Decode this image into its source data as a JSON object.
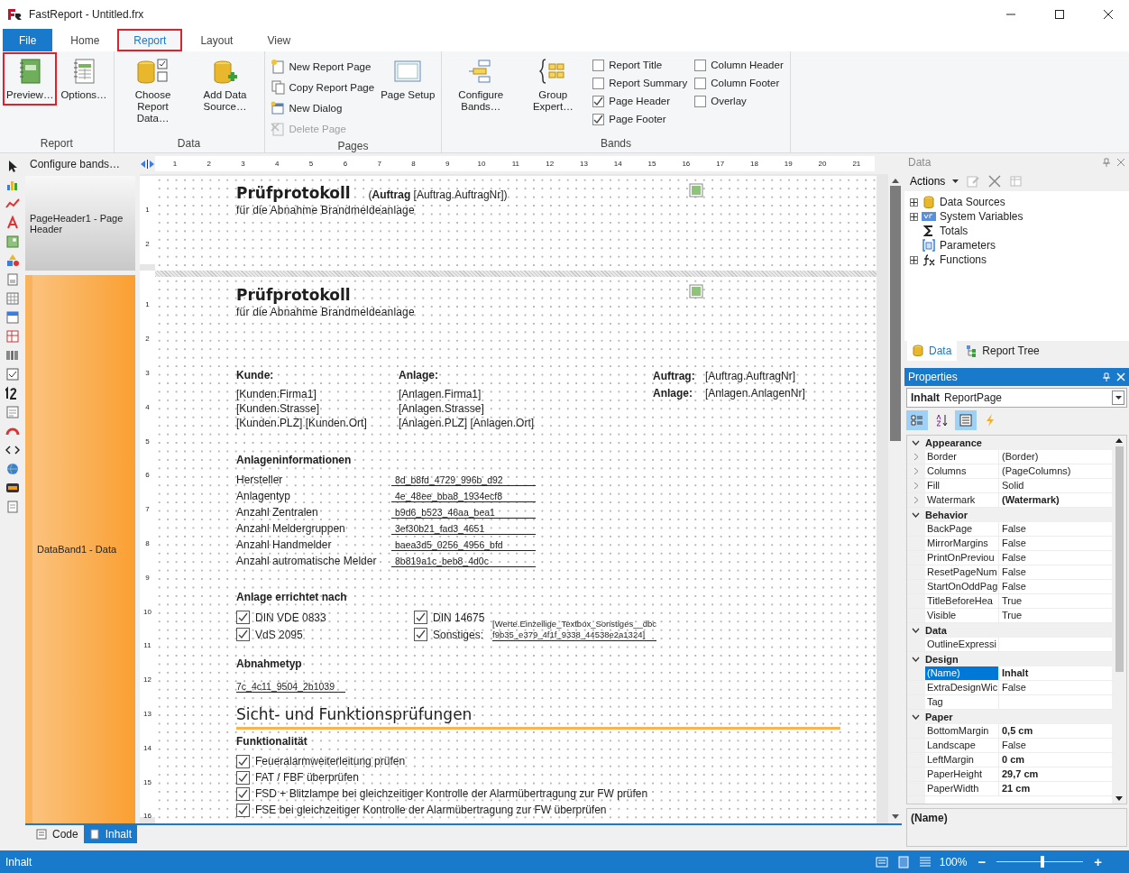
{
  "window": {
    "title": "FastReport - Untitled.frx"
  },
  "ribbon_tabs": [
    {
      "label": "File",
      "kind": "file",
      "selected": false,
      "highlighted": false
    },
    {
      "label": "Home",
      "kind": "tab",
      "selected": false,
      "highlighted": false
    },
    {
      "label": "Report",
      "kind": "tab",
      "selected": true,
      "highlighted": true
    },
    {
      "label": "Layout",
      "kind": "tab",
      "selected": false,
      "highlighted": false
    },
    {
      "label": "View",
      "kind": "tab",
      "selected": false,
      "highlighted": false
    }
  ],
  "ribbon_groups": [
    {
      "label": "Report",
      "items": [
        {
          "kind": "preview",
          "label": "Preview…",
          "highlighted": true
        },
        {
          "kind": "options",
          "label": "Options…",
          "highlighted": false
        }
      ]
    },
    {
      "label": "Data",
      "items": [
        {
          "kind": "choose-data",
          "label": "Choose Report Data…",
          "highlighted": false
        },
        {
          "kind": "add-source",
          "label": "Add Data Source…",
          "highlighted": false
        }
      ]
    },
    {
      "label": "Pages",
      "items": [
        {
          "kind": "new-page",
          "label": "New Report Page",
          "disabled": false
        },
        {
          "kind": "copy-page",
          "label": "Copy Report Page",
          "disabled": false
        },
        {
          "kind": "new-dialog",
          "label": "New Dialog",
          "disabled": false
        },
        {
          "kind": "delete-page",
          "label": "Delete Page",
          "disabled": true
        },
        {
          "kind": "page-setup",
          "label": "Page Setup",
          "highlighted": false
        }
      ]
    },
    {
      "label": "Bands",
      "items": [
        {
          "kind": "configure-bands",
          "label": "Configure Bands…",
          "highlighted": false
        },
        {
          "kind": "group-expert",
          "label": "Group Expert…",
          "highlighted": false
        },
        {
          "kind": "check",
          "label": "Report Title",
          "checked": false
        },
        {
          "kind": "check",
          "label": "Report Summary",
          "checked": false
        },
        {
          "kind": "check",
          "label": "Page Header",
          "checked": true
        },
        {
          "kind": "check",
          "label": "Page Footer",
          "checked": true
        },
        {
          "kind": "check",
          "label": "Column Header",
          "checked": false
        },
        {
          "kind": "check",
          "label": "Column Footer",
          "checked": false
        },
        {
          "kind": "check",
          "label": "Overlay",
          "checked": false
        }
      ]
    }
  ],
  "designer": {
    "hint": "Configure bands…",
    "ruler": [
      "1",
      "2",
      "3",
      "4",
      "5",
      "6",
      "7",
      "8",
      "9",
      "10",
      "11",
      "12",
      "13",
      "14",
      "15",
      "16",
      "17",
      "18",
      "19",
      "20",
      "21"
    ],
    "page_header": {
      "band_label": "PageHeader1 - Page Header",
      "ruler": [
        "1",
        "2"
      ],
      "title": "Prüfprotokoll",
      "order_ref": "(**Auftrag** [Auftrag.AuftragNr])",
      "subtitle": "für die Abnahme Brandmeldeanlage"
    },
    "data_band": {
      "band_label": "DataBand1 - Data",
      "ruler": [
        "1",
        "2",
        "3",
        "4",
        "5",
        "6",
        "7",
        "8",
        "9",
        "10",
        "11",
        "12",
        "13",
        "14",
        "15",
        "16"
      ],
      "title": "Prüfprotokoll",
      "subtitle": "für die Abnahme Brandmeldeanlage",
      "addresses": [
        {
          "heading": "Kunde:",
          "lines": [
            "[Kunden.Firma1]",
            "[Kunden.Strasse]",
            "[Kunden.PLZ] [Kunden.Ort]"
          ]
        },
        {
          "heading": "Anlage:",
          "lines": [
            "[Anlagen.Firma1]",
            "[Anlagen.Strasse]",
            "[Anlagen.PLZ] [Anlagen.Ort]"
          ]
        }
      ],
      "references": [
        {
          "label": "Auftrag:",
          "value": "[Auftrag.AuftragNr]"
        },
        {
          "label": "Anlage:",
          "value": "[Anlagen.AnlagenNr]"
        }
      ],
      "info": {
        "heading": "Anlageninformationen",
        "rows": [
          {
            "label": "Hersteller",
            "value": "8d_b8fd_4729_996b_d92"
          },
          {
            "label": "Anlagentyp",
            "value": "4e_48ee_bba8_1934ecf8"
          },
          {
            "label": "Anzahl Zentralen",
            "value": "b9d6_b523_46aa_bea1"
          },
          {
            "label": "Anzahl Meldergruppen",
            "value": "3ef30b21_fad3_4651"
          },
          {
            "label": "Anzahl Handmelder",
            "value": "baea3d5_0256_4956_bfd"
          },
          {
            "label": "Anzahl autromatische Melder",
            "value": "8b819a1c_beb8_4d0c"
          }
        ]
      },
      "standards": {
        "heading": "Anlage errichtet nach",
        "items": [
          {
            "label": "DIN VDE 0833",
            "checked": true
          },
          {
            "label": "VdS 2095",
            "checked": true
          },
          {
            "label": "DIN 14675",
            "checked": true
          },
          {
            "label": "Sonstiges:",
            "checked": true
          }
        ],
        "other_field": [
          "[Werte.Einzeilige_Textbox_Sonstiges__dbc",
          "f9b35_e379_4f1f_9338_44538e2a1324]"
        ]
      },
      "acceptance": {
        "heading": "Abnahmetyp",
        "value": "7c_4c11_9504_2b1039"
      },
      "section_title": "Sicht- und Funktionsprüfungen",
      "checks": {
        "heading": "Funktionalität",
        "items": [
          {
            "label": "Feueralarmweiterleitung prüfen",
            "checked": true
          },
          {
            "label": "FAT / FBF überprüfen",
            "checked": true
          },
          {
            "label": "FSD + Blitzlampe bei gleichzeitiger Kontrolle der Alarmübertragung zur FW prüfen",
            "checked": true
          },
          {
            "label": "FSE bei gleichzeitiger Kontrolle der Alarmübertragung zur FW überprüfen",
            "checked": true
          }
        ]
      }
    },
    "page_tabs": [
      {
        "label": "Code",
        "kind": "code",
        "selected": false
      },
      {
        "label": "Inhalt",
        "kind": "page",
        "selected": true
      }
    ]
  },
  "data_panel": {
    "title": "Data",
    "actions": "Actions",
    "tree": [
      {
        "label": "Data Sources",
        "kind": "database",
        "leaf": false
      },
      {
        "label": "System Variables",
        "kind": "variable",
        "leaf": false
      },
      {
        "label": "Totals",
        "kind": "sum",
        "leaf": true
      },
      {
        "label": "Parameters",
        "kind": "parameter",
        "leaf": true
      },
      {
        "label": "Functions",
        "kind": "function",
        "leaf": false
      }
    ],
    "tabs": [
      {
        "label": "Data",
        "kind": "database",
        "selected": true
      },
      {
        "label": "Report Tree",
        "kind": "tree",
        "selected": false
      }
    ]
  },
  "properties": {
    "title": "Properties",
    "object_name": "Inhalt",
    "object_type": "ReportPage",
    "categories": [
      {
        "label": "Appearance",
        "rows": [
          {
            "name": "Border",
            "value": "(Border)",
            "bold": false,
            "selected": false,
            "expandable": true
          },
          {
            "name": "Columns",
            "value": "(PageColumns)",
            "bold": false,
            "selected": false,
            "expandable": true
          },
          {
            "name": "Fill",
            "value": "Solid",
            "bold": false,
            "selected": false,
            "expandable": true
          },
          {
            "name": "Watermark",
            "value": "(Watermark)",
            "bold": true,
            "selected": false,
            "expandable": true
          }
        ]
      },
      {
        "label": "Behavior",
        "rows": [
          {
            "name": "BackPage",
            "value": "False",
            "bold": false,
            "selected": false,
            "expandable": false
          },
          {
            "name": "MirrorMargins",
            "value": "False",
            "bold": false,
            "selected": false,
            "expandable": false
          },
          {
            "name": "PrintOnPreviou",
            "value": "False",
            "bold": false,
            "selected": false,
            "expandable": false
          },
          {
            "name": "ResetPageNum",
            "value": "False",
            "bold": false,
            "selected": false,
            "expandable": false
          },
          {
            "name": "StartOnOddPag",
            "value": "False",
            "bold": false,
            "selected": false,
            "expandable": false
          },
          {
            "name": "TitleBeforeHea",
            "value": "True",
            "bold": false,
            "selected": false,
            "expandable": false
          },
          {
            "name": "Visible",
            "value": "True",
            "bold": false,
            "selected": false,
            "expandable": false
          }
        ]
      },
      {
        "label": "Data",
        "rows": [
          {
            "name": "OutlineExpressi",
            "selected": false,
            "expandable": false
          }
        ]
      },
      {
        "label": "Design",
        "rows": [
          {
            "name": "(Name)",
            "value": "Inhalt",
            "bold": true,
            "selected": true,
            "expandable": false
          },
          {
            "name": "ExtraDesignWic",
            "value": "False",
            "bold": false,
            "selected": false,
            "expandable": false
          },
          {
            "name": "Tag",
            "selected": false,
            "expandable": false
          }
        ]
      },
      {
        "label": "Paper",
        "rows": [
          {
            "name": "BottomMargin",
            "value": "0,5 cm",
            "bold": true,
            "selected": false,
            "expandable": false
          },
          {
            "name": "Landscape",
            "value": "False",
            "bold": false,
            "selected": false,
            "expandable": false
          },
          {
            "name": "LeftMargin",
            "value": "0 cm",
            "bold": true,
            "selected": false,
            "expandable": false
          },
          {
            "name": "PaperHeight",
            "value": "29,7 cm",
            "bold": true,
            "selected": false,
            "expandable": false
          },
          {
            "name": "PaperWidth",
            "value": "21 cm",
            "bold": true,
            "selected": false,
            "expandable": false
          }
        ]
      }
    ],
    "description": "(Name)"
  },
  "status_bar": {
    "text": "Inhalt",
    "zoom": "100%",
    "zoom_out": "−",
    "zoom_in": "+",
    "level": 0.53
  }
}
